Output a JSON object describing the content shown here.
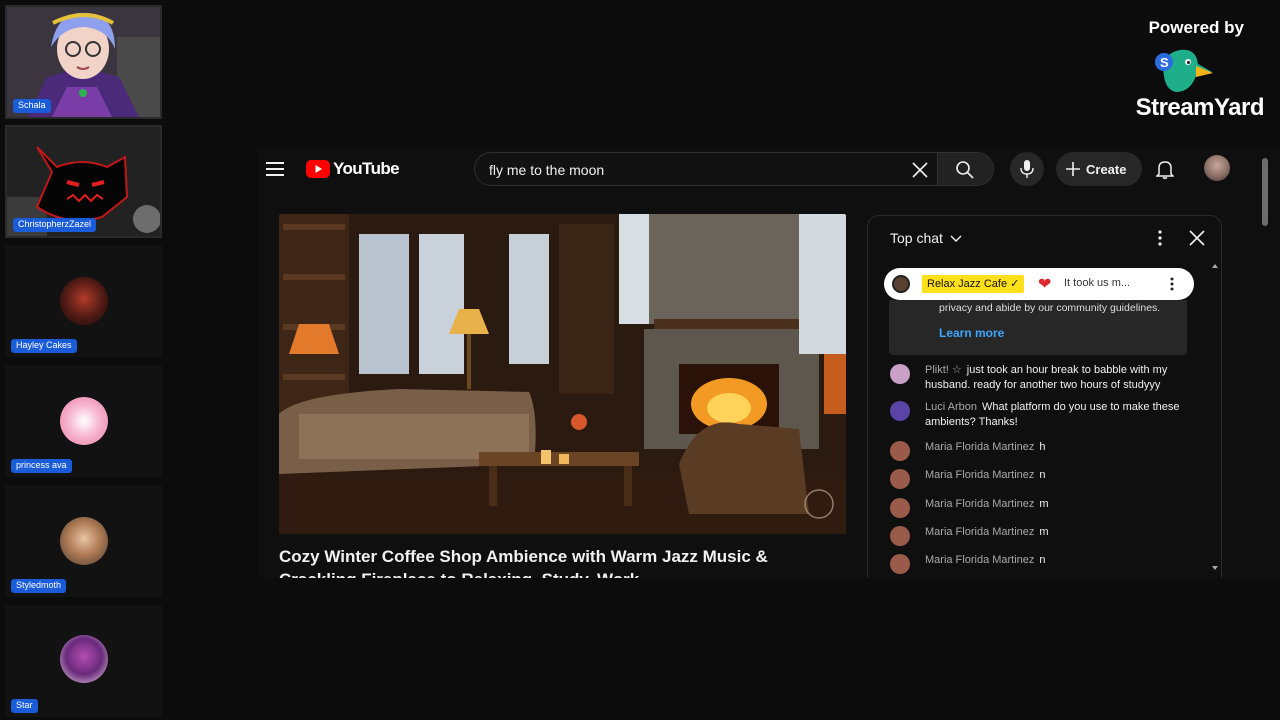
{
  "participants": [
    {
      "name": "Schala"
    },
    {
      "name": "ChristopherzZazel"
    },
    {
      "name": "Hayley Cakes"
    },
    {
      "name": "princess ava"
    },
    {
      "name": "Styledmoth"
    },
    {
      "name": "Star"
    }
  ],
  "branding": {
    "powered_by": "Powered by",
    "brand": "StreamYard"
  },
  "youtube": {
    "logo_text": "YouTube",
    "search_query": "fly me to the moon",
    "create_label": "Create",
    "video_title": "Cozy Winter Coffee Shop Ambience with Warm Jazz Music & Crackling Fireplace to Relaxing, Study, Work"
  },
  "chat": {
    "header": "Top chat",
    "pinned": {
      "channel": "Relax Jazz Cafe ✓",
      "text": "It took us m..."
    },
    "notice": {
      "text": "privacy and abide by our community guidelines.",
      "link": "Learn more"
    },
    "messages": [
      {
        "author": "Plikt! ☆",
        "text": "just took an hour break to babble with my husband. ready for another two hours of studyyy"
      },
      {
        "author": "Luci Arbon",
        "text": "What platform do you use to make these ambients? Thanks!"
      },
      {
        "author": "Maria Florida Martinez",
        "text": "h"
      },
      {
        "author": "Maria Florida Martinez",
        "text": "n"
      },
      {
        "author": "Maria Florida Martinez",
        "text": "m"
      },
      {
        "author": "Maria Florida Martinez",
        "text": "m"
      },
      {
        "author": "Maria Florida Martinez",
        "text": "n"
      }
    ]
  },
  "colors": {
    "name_tag": "#1a5bd8",
    "yt_red": "#ff0000",
    "link_blue": "#3ea6ff",
    "pinned_tag": "#ffe01a"
  }
}
